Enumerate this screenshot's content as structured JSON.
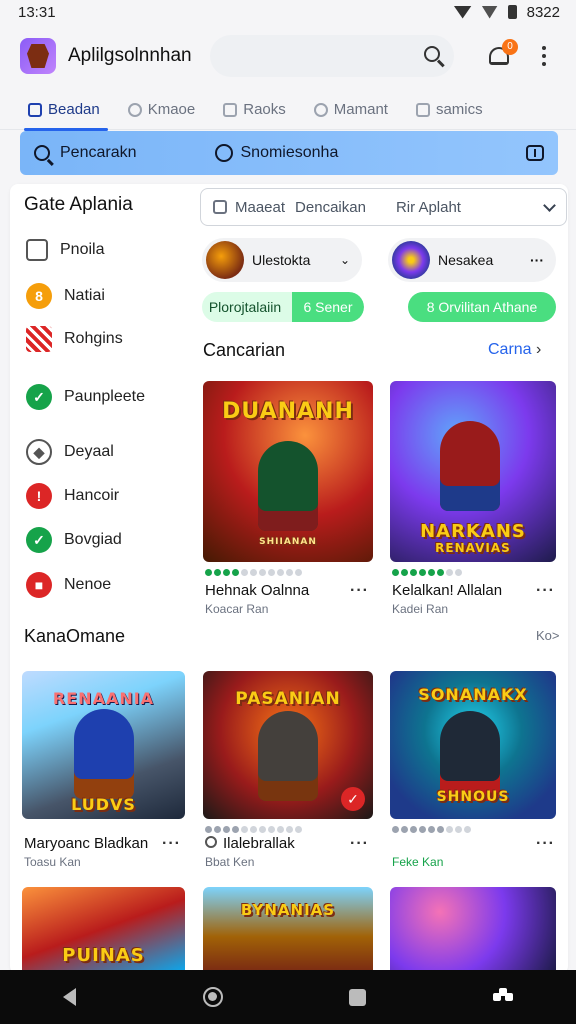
{
  "status": {
    "time": "13:31",
    "right_text": "8322"
  },
  "appbar": {
    "title": "Aplilgsolnnhan",
    "badge": "0"
  },
  "tabs": [
    {
      "label": "Beadan"
    },
    {
      "label": "Kmaoe"
    },
    {
      "label": "Raoks"
    },
    {
      "label": "Mamant"
    },
    {
      "label": "samics"
    }
  ],
  "banner": {
    "left": "Pencarakn",
    "mid": "Snomiesonha"
  },
  "sidebar": {
    "heading": "Gate Aplania",
    "items": [
      {
        "label": "Pnoila",
        "icon": "home-icon",
        "color": "#6b7280"
      },
      {
        "label": "Natiai",
        "icon": "coin-icon",
        "color": "#f59e0b"
      },
      {
        "label": "Rohgins",
        "icon": "stripes-icon",
        "color": "#dc2626"
      },
      {
        "label": "Paunpleete",
        "icon": "check-icon",
        "color": "#16a34a"
      },
      {
        "label": "Deyaal",
        "icon": "shield-icon",
        "color": "#6b7280"
      },
      {
        "label": "Hancoir",
        "icon": "alert-icon",
        "color": "#dc2626"
      },
      {
        "label": "Bovgiad",
        "icon": "check-icon",
        "color": "#16a34a"
      },
      {
        "label": "Nenoe",
        "icon": "stop-icon",
        "color": "#dc2626"
      }
    ]
  },
  "filter": {
    "a": "Maaeat",
    "b": "Dencaikan",
    "c": "Rir Aplaht"
  },
  "selectors": [
    {
      "label": "Ulestokta"
    },
    {
      "label": "Nesakea"
    }
  ],
  "pill_buttons": [
    {
      "label_a": "Plorojtalaiin",
      "label_b": "6 Sener"
    },
    {
      "label": "8 Orvilitan Athane"
    }
  ],
  "sections": {
    "first": {
      "title": "Cancarian",
      "link": "Carna"
    },
    "second": {
      "title": "KanaOmane",
      "link": "Ko>"
    }
  },
  "games_row1": [
    {
      "art_title": "DUANANH",
      "art_sub": "SHIIANAN",
      "name": "Hehnak Oalnna",
      "sub": "Koacar Ran"
    },
    {
      "art_title": "NARKANS",
      "art_sub": "RENAVIAS",
      "name": "Kelalkan! Allalan",
      "sub": "Kadei Ran"
    }
  ],
  "games_row2": [
    {
      "art_title": "RENAANIA",
      "art_sub": "LUDVS",
      "name": "Maryoanc Bladkan",
      "sub": "Toasu Kan"
    },
    {
      "art_title": "PASANIAN",
      "art_sub": "",
      "name": "Ilalebrallak",
      "sub": "Bbat Ken"
    },
    {
      "art_title": "SONANAKX",
      "art_sub": "SHNOUS",
      "name": "",
      "sub": "Feke Kan"
    }
  ],
  "games_row3": [
    {
      "art_title": "PUINAS"
    },
    {
      "art_title": "BYNANIAS"
    },
    {
      "art_title": ""
    }
  ]
}
